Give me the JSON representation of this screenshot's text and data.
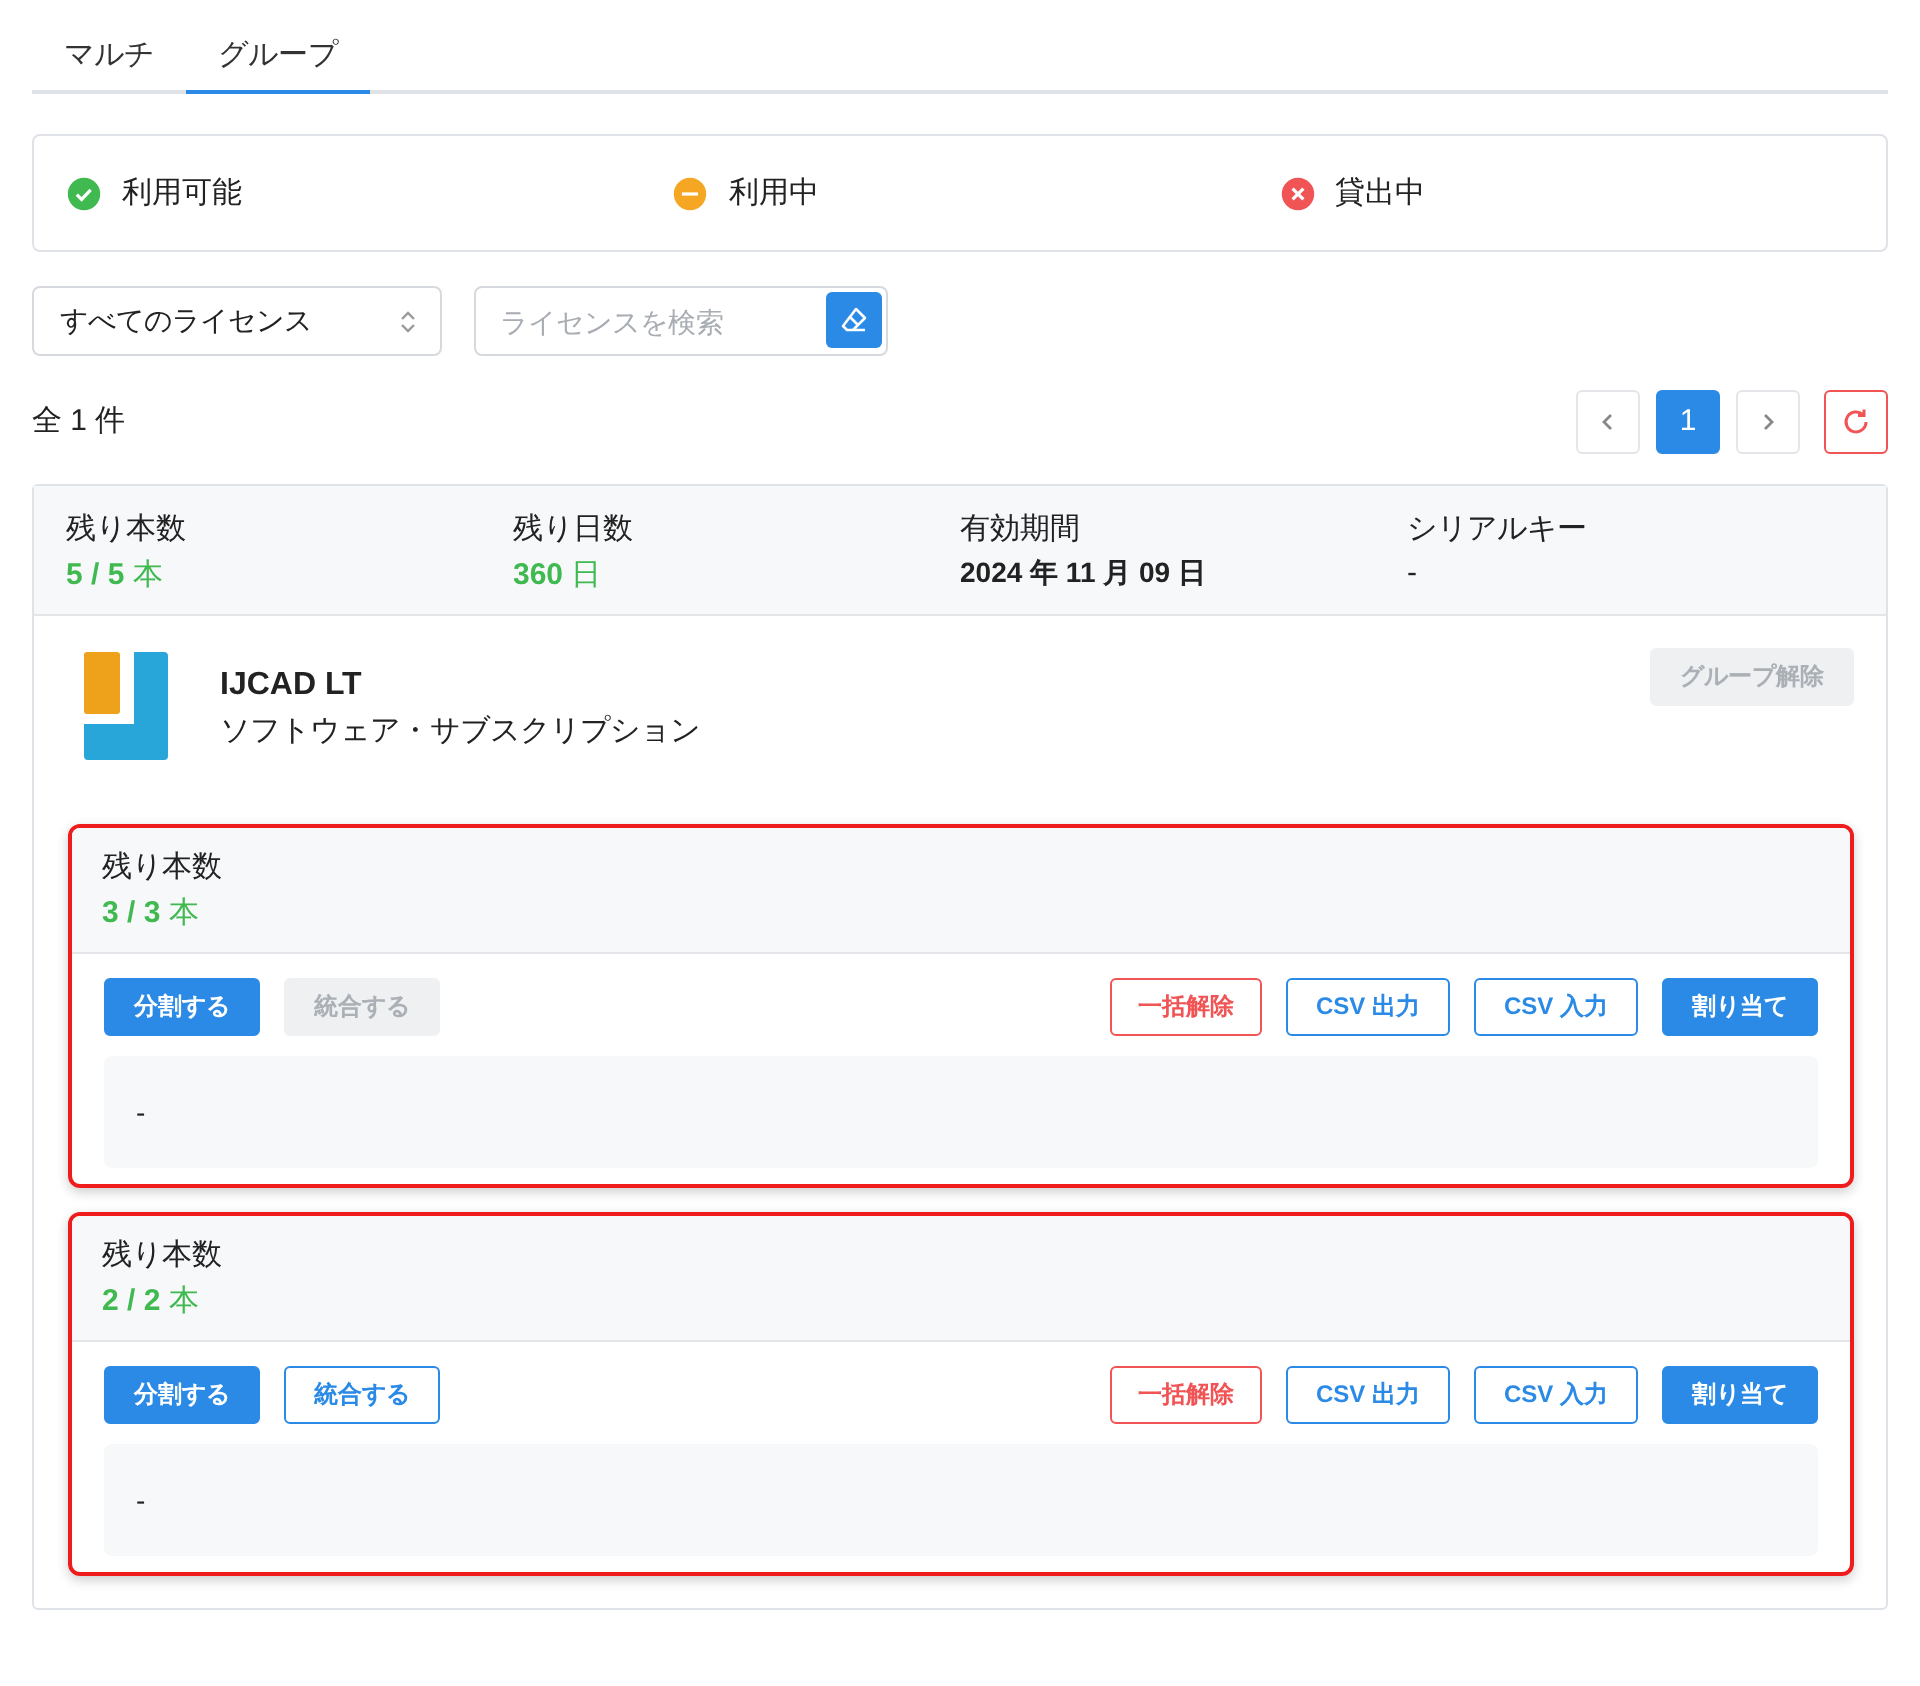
{
  "tabs": [
    {
      "label": "マルチ",
      "selected": false
    },
    {
      "label": "グループ",
      "selected": true
    }
  ],
  "legend": [
    {
      "kind": "available",
      "label": "利用可能",
      "color": "#3fb950"
    },
    {
      "kind": "in_use",
      "label": "利用中",
      "color": "#f5a623"
    },
    {
      "kind": "lent",
      "label": "貸出中",
      "color": "#f05454"
    }
  ],
  "filter": {
    "value": "すべてのライセンス"
  },
  "search": {
    "placeholder": "ライセンスを検索"
  },
  "total": "全 1 件",
  "pagination": {
    "pages": [
      {
        "label": "1",
        "selected": true
      }
    ]
  },
  "license": {
    "summary": [
      {
        "label": "残り本数",
        "value": "**5 / 5** 本",
        "kind": "green"
      },
      {
        "label": "残り日数",
        "value": "**360** 日",
        "kind": "green"
      },
      {
        "label": "有効期間",
        "value": "2024 年 11 月 09 日",
        "kind": "bold"
      },
      {
        "label": "シリアルキー",
        "value": "-",
        "kind": "plain"
      }
    ],
    "product": {
      "name": "IJCAD LT",
      "subtitle": "ソフトウェア・サブスクリプション"
    },
    "ungroup_button": {
      "label": "グループ解除",
      "disabled": true
    },
    "groups": [
      {
        "highlighted": true,
        "label": "残り本数",
        "count": "**3 / 3** 本",
        "buttons": [
          {
            "label": "分割する",
            "kind": "primary",
            "disabled": false
          },
          {
            "label": "統合する",
            "kind": "outline",
            "disabled": true
          }
        ],
        "actions": [
          {
            "label": "一括解除",
            "kind": "danger",
            "disabled": false
          },
          {
            "label": "CSV 出力",
            "kind": "outline",
            "disabled": false
          },
          {
            "label": "CSV 入力",
            "kind": "outline",
            "disabled": false
          },
          {
            "label": "割り当て",
            "kind": "primary",
            "disabled": false
          }
        ],
        "note": "-"
      },
      {
        "highlighted": true,
        "label": "残り本数",
        "count": "**2 / 2** 本",
        "buttons": [
          {
            "label": "分割する",
            "kind": "primary",
            "disabled": false
          },
          {
            "label": "統合する",
            "kind": "outline",
            "disabled": false
          }
        ],
        "actions": [
          {
            "label": "一括解除",
            "kind": "danger",
            "disabled": false
          },
          {
            "label": "CSV 出力",
            "kind": "outline",
            "disabled": false
          },
          {
            "label": "CSV 入力",
            "kind": "outline",
            "disabled": false
          },
          {
            "label": "割り当て",
            "kind": "primary",
            "disabled": false
          }
        ],
        "note": "-"
      }
    ]
  }
}
